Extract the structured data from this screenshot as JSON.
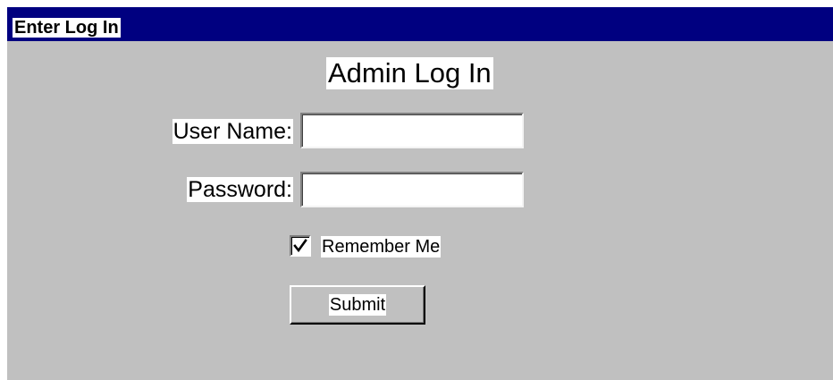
{
  "window": {
    "title": "Enter Log In",
    "titlebar_color": "#000080",
    "background_color": "#c0c0c0"
  },
  "form": {
    "heading": "Admin Log In",
    "username": {
      "label": "User Name:",
      "value": "",
      "placeholder": ""
    },
    "password": {
      "label": "Password:",
      "value": "",
      "placeholder": ""
    },
    "remember": {
      "label": "Remember Me",
      "checked": true,
      "icon": "checkmark-icon"
    },
    "submit_label": "Submit"
  }
}
